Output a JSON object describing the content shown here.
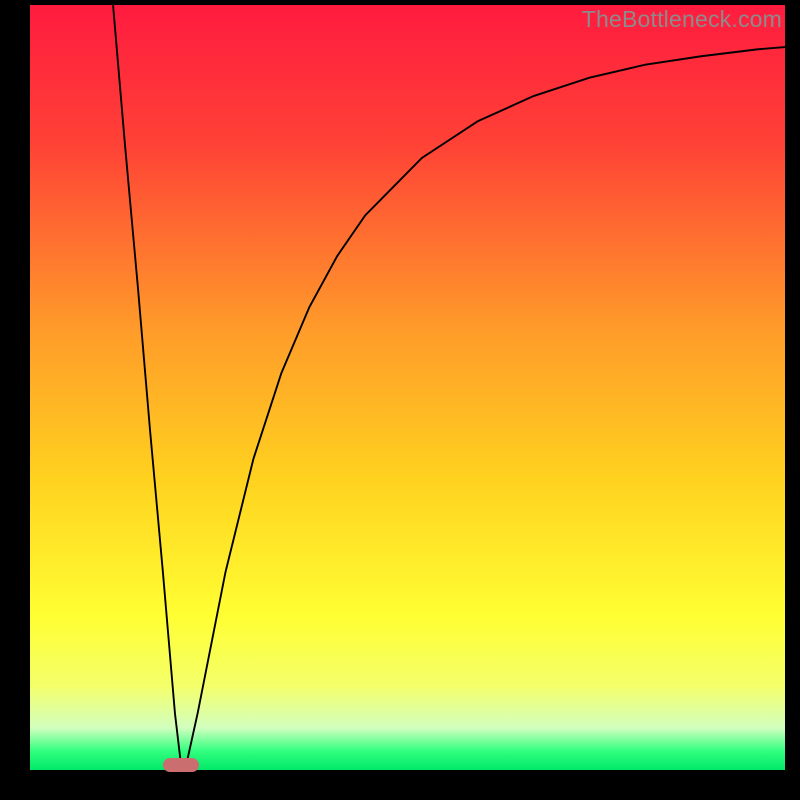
{
  "watermark": "TheBottleneck.com",
  "chart_data": {
    "type": "line",
    "title": "",
    "xlabel": "",
    "ylabel": "",
    "xlim": [
      0,
      100
    ],
    "ylim": [
      0,
      100
    ],
    "grid": false,
    "legend": false,
    "gradient_stops": [
      {
        "pos": 0.0,
        "color": "#ff1b3f"
      },
      {
        "pos": 0.18,
        "color": "#ff4136"
      },
      {
        "pos": 0.42,
        "color": "#ff9a2a"
      },
      {
        "pos": 0.62,
        "color": "#ffd21f"
      },
      {
        "pos": 0.8,
        "color": "#ffff33"
      },
      {
        "pos": 0.89,
        "color": "#f4ff6a"
      },
      {
        "pos": 0.945,
        "color": "#d2ffbf"
      },
      {
        "pos": 0.975,
        "color": "#32ff7f"
      },
      {
        "pos": 1.0,
        "color": "#00e868"
      }
    ],
    "series": [
      {
        "name": "left-branch",
        "x": [
          11.0,
          12.6,
          14.3,
          15.9,
          17.6,
          19.2,
          20.0
        ],
        "values": [
          100.0,
          81.5,
          63.0,
          44.4,
          25.9,
          7.4,
          0.7
        ]
      },
      {
        "name": "right-branch",
        "x": [
          20.7,
          22.2,
          25.9,
          29.6,
          33.3,
          37.0,
          40.7,
          44.4,
          51.9,
          59.3,
          66.7,
          74.1,
          81.5,
          88.9,
          96.3,
          100.0
        ],
        "values": [
          0.7,
          7.4,
          25.9,
          40.7,
          51.9,
          60.5,
          67.2,
          72.5,
          80.0,
          84.8,
          88.1,
          90.5,
          92.2,
          93.3,
          94.2,
          94.5
        ]
      }
    ],
    "marker": {
      "x": 20.0,
      "y": 0.7
    }
  }
}
